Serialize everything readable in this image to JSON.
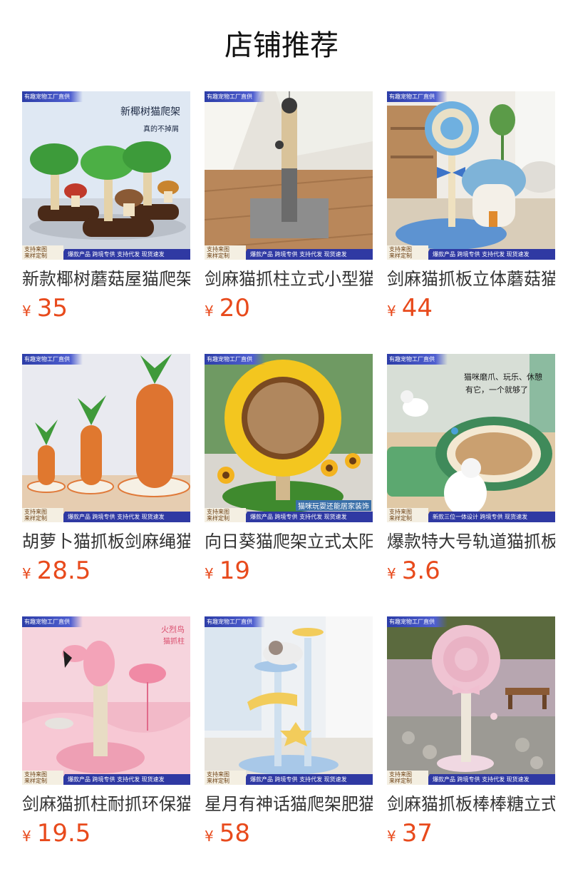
{
  "page": {
    "title": "店铺推荐"
  },
  "colors": {
    "price": "#e84a1c",
    "tag": "#2f39a3"
  },
  "products": [
    {
      "name": "新款椰树蘑菇屋猫爬架",
      "currency": "¥",
      "price": "35",
      "tag": "有趣宠物工厂直供",
      "badge_l1": "支持来图",
      "badge_l2": "来样定制",
      "strip": "爆款产品 跨境专供 支持代发 现货速发",
      "overlay1": "新椰树猫爬架",
      "overlay2": "真的不掉屑",
      "icon": "coconut-tree-cat-tree-icon"
    },
    {
      "name": "剑麻猫抓柱立式小型猫",
      "currency": "¥",
      "price": "20",
      "tag": "有趣宠物工厂直供",
      "badge_l1": "支持来图",
      "badge_l2": "来样定制",
      "strip": "爆款产品 跨境专供 支持代发 现货速发",
      "icon": "sisal-post-icon"
    },
    {
      "name": "剑麻猫抓板立体蘑菇猫",
      "currency": "¥",
      "price": "44",
      "tag": "有趣宠物工厂直供",
      "badge_l1": "支持来图",
      "badge_l2": "来样定制",
      "strip": "爆款产品 跨境专供 支持代发 现货速发",
      "icon": "lollipop-mushroom-icon"
    },
    {
      "name": "胡萝卜猫抓板剑麻绳猫",
      "currency": "¥",
      "price": "28.5",
      "tag": "有趣宠物工厂直供",
      "badge_l1": "支持来图",
      "badge_l2": "来样定制",
      "strip": "爆款产品 跨境专供 支持代发 现货速发",
      "icon": "carrot-scratcher-icon"
    },
    {
      "name": "向日葵猫爬架立式太阳",
      "currency": "¥",
      "price": "19",
      "tag": "有趣宠物工厂直供",
      "badge_l1": "支持来图",
      "badge_l2": "来样定制",
      "strip": "爆款产品 跨境专供 支持代发 现货速发",
      "overlay1": "猫咪玩耍还能居家装饰",
      "icon": "sunflower-scratcher-icon"
    },
    {
      "name": "爆款特大号轨道猫抓板",
      "currency": "¥",
      "price": "3.6",
      "tag": "有趣宠物工厂直供",
      "badge_l1": "支持来图",
      "badge_l2": "来样定制",
      "strip": "新款三位一体设计 跨境专供 现货速发",
      "overlay1": "猫咪磨爪、玩乐、休憩",
      "overlay2": "有它，一个就够了",
      "icon": "track-scratcher-icon"
    },
    {
      "name": "剑麻猫抓柱耐抓环保猫",
      "currency": "¥",
      "price": "19.5",
      "tag": "有趣宠物工厂直供",
      "badge_l1": "支持来图",
      "badge_l2": "来样定制",
      "strip": "爆款产品 跨境专供 支持代发 现货速发",
      "overlay1": "火烈鸟",
      "overlay2": "猫抓柱",
      "icon": "flamingo-post-icon"
    },
    {
      "name": "星月有神话猫爬架肥猫",
      "currency": "¥",
      "price": "58",
      "tag": "有趣宠物工厂直供",
      "badge_l1": "支持来图",
      "badge_l2": "来样定制",
      "strip": "爆款产品 跨境专供 支持代发 现货速发",
      "icon": "star-moon-cat-tree-icon"
    },
    {
      "name": "剑麻猫抓板棒棒糖立式",
      "currency": "¥",
      "price": "37",
      "tag": "有趣宠物工厂直供",
      "badge_l1": "支持来图",
      "badge_l2": "来样定制",
      "strip": "爆款产品 跨境专供 支持代发 现货速发",
      "icon": "lollipop-post-icon"
    }
  ]
}
